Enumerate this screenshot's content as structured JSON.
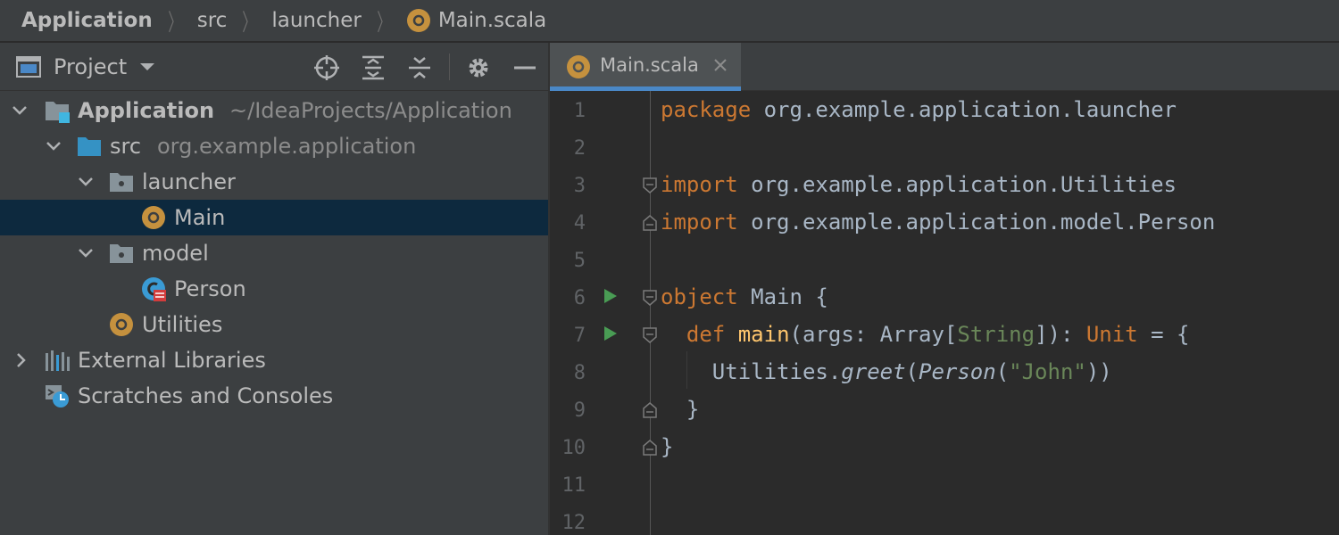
{
  "breadcrumb": {
    "items": [
      "Application",
      "src",
      "launcher",
      "Main.scala"
    ]
  },
  "project_panel": {
    "title": "Project",
    "tools": [
      "locate-icon",
      "expand-all-icon",
      "collapse-all-icon",
      "gear-icon",
      "minimize-icon"
    ],
    "tree": {
      "application": {
        "label": "Application",
        "hint": "~/IdeaProjects/Application"
      },
      "src": {
        "label": "src",
        "hint": "org.example.application"
      },
      "launcher": {
        "label": "launcher"
      },
      "main": {
        "label": "Main"
      },
      "model": {
        "label": "model"
      },
      "person": {
        "label": "Person"
      },
      "utilities": {
        "label": "Utilities"
      },
      "external_libraries": {
        "label": "External Libraries"
      },
      "scratches": {
        "label": "Scratches and Consoles"
      }
    }
  },
  "editor": {
    "tab": {
      "label": "Main.scala"
    },
    "line_numbers": [
      "1",
      "2",
      "3",
      "4",
      "5",
      "6",
      "7",
      "8",
      "9",
      "10",
      "11",
      "12"
    ],
    "code": {
      "l1_kw": "package",
      "l1_rest": " org.example.application.launcher",
      "l3_kw": "import",
      "l3_rest": " org.example.application.Utilities",
      "l4_kw": "import",
      "l4_rest": " org.example.application.model.Person",
      "l6_kw": "object",
      "l6_rest": " Main {",
      "l7_indent": "  ",
      "l7_kw": "def",
      "l7_sp": " ",
      "l7_fn": "main",
      "l7_a": "(args: Array[",
      "l7_type": "String",
      "l7_b": "]): ",
      "l7_unit": "Unit",
      "l7_c": " = {",
      "l8_a": "    Utilities.",
      "l8_fn": "greet",
      "l8_b": "(",
      "l8_cls": "Person",
      "l8_c": "(",
      "l8_str": "\"John\"",
      "l8_d": "))",
      "l9": "  }",
      "l10": "}"
    }
  },
  "colors": {
    "selection": "#0d293e",
    "keyword": "#cc7832",
    "function": "#ffc66d",
    "string": "#6a8759",
    "tab_accent": "#4a88c7",
    "run": "#499c54"
  }
}
